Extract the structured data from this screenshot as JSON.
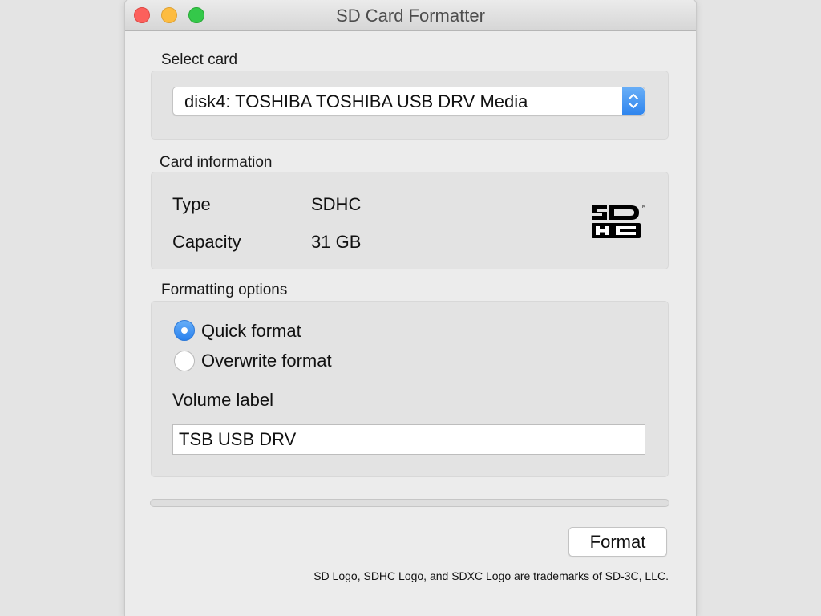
{
  "window": {
    "title": "SD Card Formatter"
  },
  "select_card": {
    "label": "Select card",
    "selected": "disk4: TOSHIBA TOSHIBA USB DRV Media"
  },
  "card_info": {
    "label": "Card information",
    "type_label": "Type",
    "type_value": "SDHC",
    "capacity_label": "Capacity",
    "capacity_value": "31 GB",
    "logo_icon": "sdhc-logo-icon"
  },
  "formatting": {
    "label": "Formatting options",
    "options": [
      {
        "label": "Quick format",
        "selected": true
      },
      {
        "label": "Overwrite format",
        "selected": false
      }
    ],
    "volume_label_caption": "Volume label",
    "volume_label_value": "TSB USB DRV"
  },
  "progress": {
    "fraction": 0
  },
  "actions": {
    "format_label": "Format"
  },
  "footer": {
    "trademark": "SD Logo, SDHC Logo, and SDXC Logo are trademarks of SD-3C, LLC."
  },
  "colors": {
    "accent": "#2f85ee",
    "close": "#fc605c",
    "minimize": "#fdbc40",
    "maximize": "#34c84a"
  }
}
